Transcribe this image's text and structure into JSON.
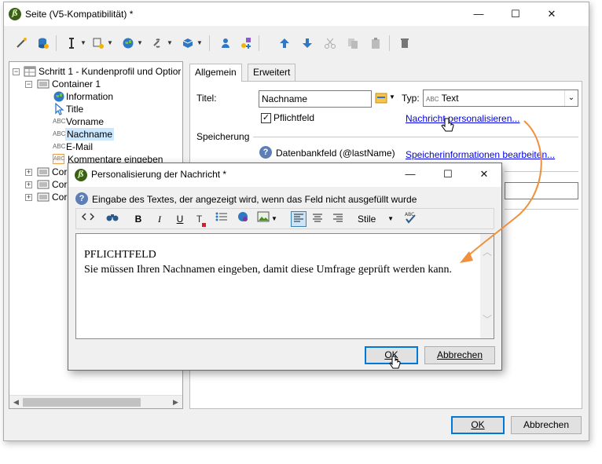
{
  "main_window": {
    "title": "Seite (V5-Kompatibilität) *",
    "window_controls": {
      "minimize": "—",
      "maximize": "☐",
      "close": "✕"
    },
    "toolbar_icons": [
      "magic-wand-icon",
      "database-icon",
      "text-cursor-icon",
      "form-filter-icon",
      "globe-icon",
      "link-icon",
      "cube-icon",
      "person-icon",
      "add-shapes-icon",
      "arrow-up-icon",
      "arrow-down-icon",
      "cut-icon",
      "copy-icon",
      "paste-icon",
      "trash-icon"
    ]
  },
  "tree": {
    "root": "Schritt 1 - Kundenprofil und Optior",
    "container": "Container 1",
    "items": [
      {
        "label": "Information",
        "icon": "globe-icon"
      },
      {
        "label": "Title",
        "icon": "cursor-icon"
      },
      {
        "label": "Vorname",
        "icon": "abc-icon"
      },
      {
        "label": "Nachname",
        "icon": "abc-icon",
        "selected": true
      },
      {
        "label": "E-Mail",
        "icon": "abc-icon"
      },
      {
        "label": "Kommentare eingeben",
        "icon": "abc-box-icon"
      }
    ],
    "collapsed": [
      "Cor",
      "Cor",
      "Cor"
    ],
    "abc_glyph": "ABC",
    "expanded_symbol": "−",
    "collapsed_symbol": "+"
  },
  "tabs": [
    "Allgemein",
    "Erweitert"
  ],
  "form": {
    "titel_label": "Titel:",
    "titel_value": "Nachname",
    "typ_label": "Typ:",
    "typ_glyph": "ABC",
    "typ_value": "Text",
    "pflichtfeld_label": "Pflichtfeld",
    "pflichtfeld_checked": true,
    "personalize_link": "Nachricht personalisieren...",
    "speicherung_label": "Speicherung",
    "datenbankfeld_text": "Datenbankfeld (@lastName)",
    "storage_link": "Speicherinformationen bearbeiten..."
  },
  "main_buttons": {
    "ok": "OK",
    "cancel": "Abbrechen"
  },
  "dialog": {
    "title": "Personalisierung der Nachricht *",
    "info": "Eingabe des Textes, der angezeigt wird, wenn das Feld nicht ausgefüllt wurde",
    "style_select": "Stile",
    "toolbar_glyphs": {
      "bold": "B",
      "italic": "I",
      "underline": "U",
      "clear_format": "T"
    },
    "editor_line1": "PFLICHTFELD",
    "editor_line2": "Sie müssen Ihren Nachnamen eingeben, damit diese Umfrage geprüft werden kann.",
    "buttons": {
      "ok": "OK",
      "cancel": "Abbrechen"
    },
    "window_controls": {
      "minimize": "—",
      "maximize": "☐",
      "close": "✕"
    }
  },
  "colors": {
    "accent": "#0078d7",
    "arrow": "#f0903c",
    "link": "#0000ee"
  }
}
